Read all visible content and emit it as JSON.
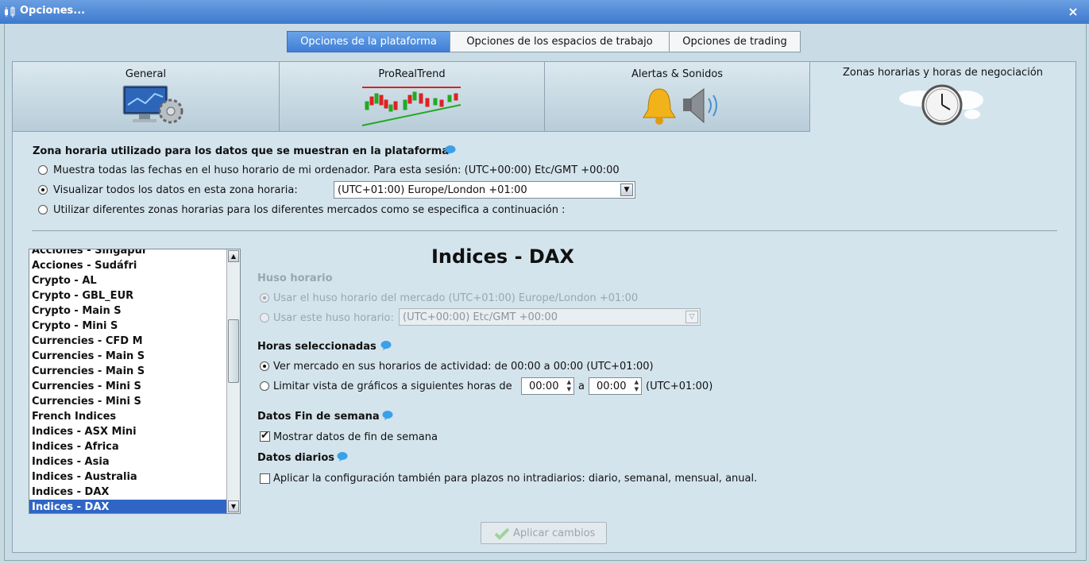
{
  "window": {
    "title": "Opciones...",
    "close_label": "×"
  },
  "top_tabs": [
    {
      "label": "Opciones de la plataforma",
      "active": true
    },
    {
      "label": "Opciones de los espacios de trabajo",
      "active": false
    },
    {
      "label": "Opciones de trading",
      "active": false
    }
  ],
  "section_tabs": [
    {
      "label": "General",
      "icon": "monitor-gear-icon",
      "active": false
    },
    {
      "label": "ProRealTrend",
      "icon": "candlestick-trend-icon",
      "active": false
    },
    {
      "label": "Alertas & Sonidos",
      "icon": "bell-speaker-icon",
      "active": false
    },
    {
      "label": "Zonas horarias y horas de negociación",
      "icon": "world-clock-icon",
      "active": true
    }
  ],
  "timezone": {
    "heading": "Zona horaria utilizado para los datos que se muestran en la plataforma",
    "option_local": "Muestra todas las fechas en el huso horario de mi ordenador. Para esta sesión: (UTC+00:00) Etc/GMT +00:00",
    "option_zone": "Visualizar todos los datos en esta zona horaria:",
    "zone_value": "(UTC+01:00) Europe/London +01:00",
    "option_markets": "Utilizar diferentes zonas horarias para los diferentes mercados como se especifica a continuación :",
    "selected": "zone"
  },
  "markets": [
    "Acciones - Singapur",
    "Acciones - Sudáfri",
    "Crypto - AL",
    "Crypto - GBL_EUR",
    "Crypto - Main S",
    "Crypto - Mini S",
    "Currencies - CFD M",
    "Currencies - Main S",
    "Currencies - Main S",
    "Currencies - Mini S",
    "Currencies - Mini S",
    "French Indices",
    "Indices - ASX Mini",
    "Indices - Africa",
    "Indices - Asia",
    "Indices - Australia",
    "Indices - DAX",
    "Indices - DAX"
  ],
  "selected_market_index": 17,
  "detail": {
    "title": "Indices - DAX",
    "huso_heading": "Huso horario",
    "huso_market": "Usar el huso horario del mercado (UTC+01:00) Europe/London +01:00",
    "huso_custom": "Usar este huso horario:",
    "huso_custom_value": "(UTC+00:00) Etc/GMT +00:00",
    "horas_heading": "Horas seleccionadas",
    "horas_all": "Ver mercado en sus horarios de actividad: de 00:00 a 00:00 (UTC+01:00)",
    "horas_limit": "Limitar vista de gráficos a siguientes horas  de",
    "hour_from": "00:00",
    "hour_sep": "a",
    "hour_to": "00:00",
    "hour_tz": "(UTC+01:00)",
    "weekend_heading": "Datos Fin de semana",
    "weekend_label": "Mostrar datos de fin de semana",
    "weekend_checked": true,
    "daily_heading": "Datos diarios",
    "daily_label": "Aplicar la configuración también para plazos no intradiarios: diario, semanal, mensual, anual.",
    "daily_checked": false
  },
  "apply_label": "Aplicar cambios",
  "colors": {
    "accent": "#3f7fd6",
    "selection": "#2f65c5",
    "info": "#3aa0e8"
  }
}
